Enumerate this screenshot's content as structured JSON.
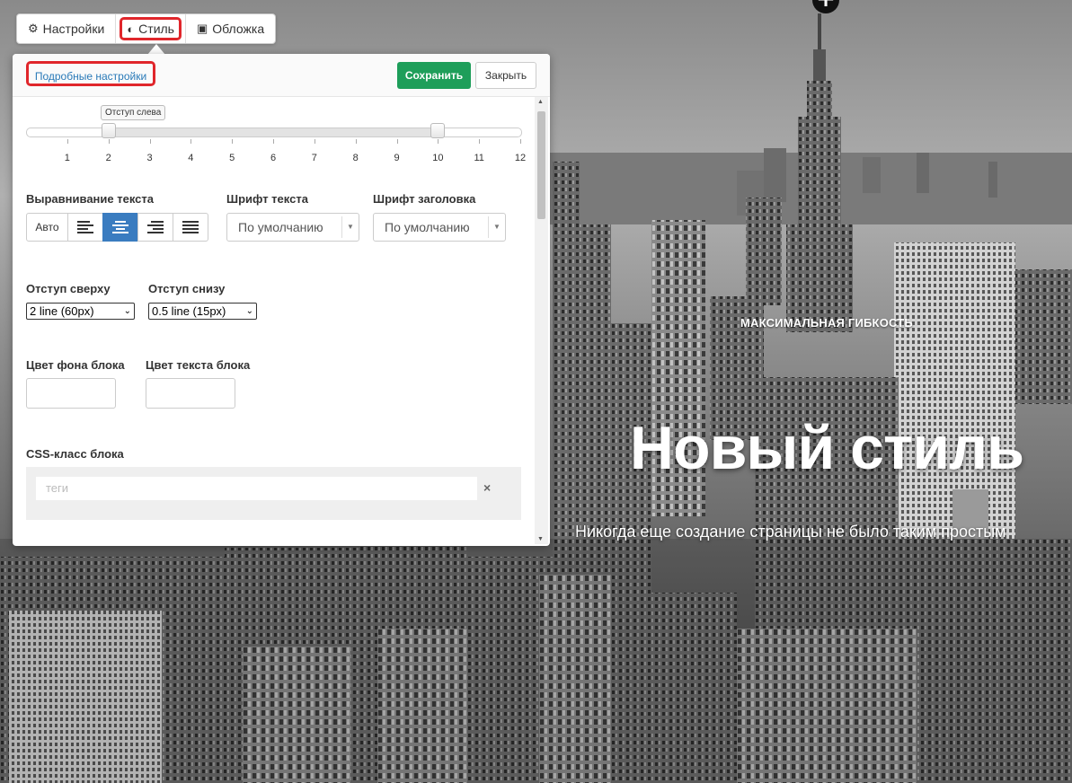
{
  "tabs": [
    {
      "label": "Настройки",
      "icon": "gear-icon"
    },
    {
      "label": "Стиль",
      "icon": "contrast-icon"
    },
    {
      "label": "Обложка",
      "icon": "image-icon"
    }
  ],
  "panel": {
    "advanced_link": "Подробные настройки",
    "save_label": "Сохранить",
    "close_label": "Закрыть",
    "slider": {
      "tooltip": "Отступ слева",
      "ticks": [
        "1",
        "2",
        "3",
        "4",
        "5",
        "6",
        "7",
        "8",
        "9",
        "10",
        "11",
        "12"
      ],
      "min": 0,
      "max": 12,
      "left_value": 2,
      "right_value": 10
    },
    "text_align": {
      "label": "Выравнивание текста",
      "auto_label": "Авто",
      "options": [
        "align-left-icon",
        "align-center-icon",
        "align-right-icon",
        "align-justify-icon"
      ],
      "selected": "align-center-icon"
    },
    "font_text": {
      "label": "Шрифт текста",
      "value": "По умолчанию"
    },
    "font_heading": {
      "label": "Шрифт заголовка",
      "value": "По умолчанию"
    },
    "padding_top": {
      "label": "Отступ сверху",
      "value": "2 line (60px)"
    },
    "padding_bottom": {
      "label": "Отступ снизу",
      "value": "0.5 line (15px)"
    },
    "bg_color": {
      "label": "Цвет фона блока",
      "value": ""
    },
    "text_color": {
      "label": "Цвет текста блока",
      "value": ""
    },
    "css_class": {
      "label": "CSS-класс блока",
      "placeholder": "теги"
    }
  },
  "hero": {
    "kicker": "МАКСИМАЛЬНАЯ ГИБКОСТЬ",
    "title": "Новый стиль",
    "subtitle": "Никогда еще создание страницы не было таким простым"
  },
  "colors": {
    "accent": "#1e9e5a",
    "highlight": "#e0262b",
    "link": "#2a7ab8",
    "active_align": "#3a7cc0"
  }
}
